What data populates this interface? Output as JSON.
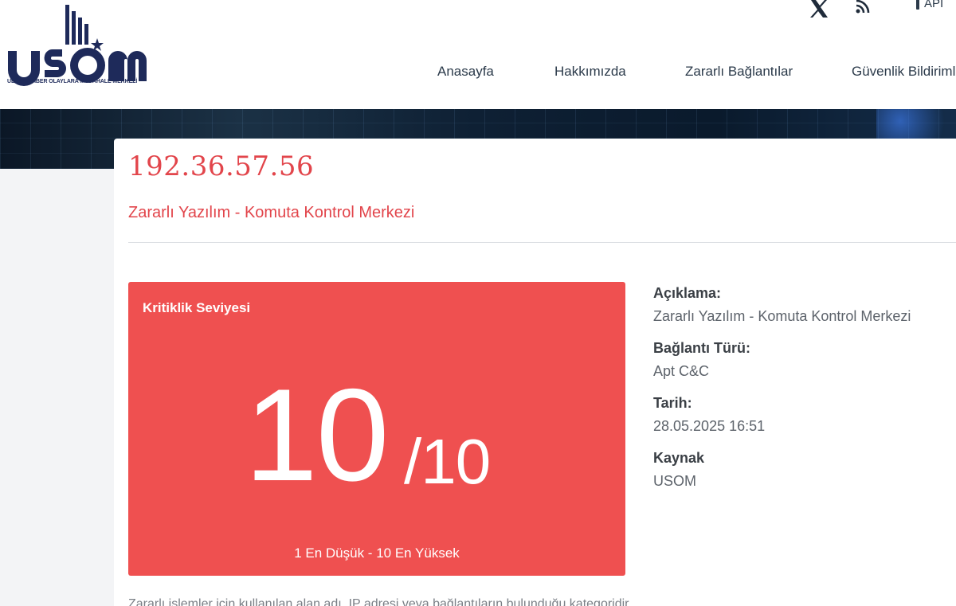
{
  "logo": {
    "text": "USOM",
    "subtitle": "ULUSAL SİBER OLAYLARA MÜDAHALE MERKEZİ"
  },
  "topbar": {
    "x_icon": "x-twitter-icon",
    "rss_icon": "rss-icon",
    "api_label": "API"
  },
  "nav": {
    "items": [
      "Anasayfa",
      "Hakkımızda",
      "Zararlı Bağlantılar",
      "Güvenlik Bildirimle"
    ]
  },
  "record": {
    "ip": "192.36.57.56",
    "subtitle": "Zararlı Yazılım - Komuta Kontrol Merkezi"
  },
  "criticality": {
    "label": "Kritiklik Seviyesi",
    "score": "10",
    "max": "/10",
    "range": "1 En Düşük - 10 En Yüksek"
  },
  "details": {
    "description_label": "Açıklama:",
    "description_value": "Zararlı Yazılım - Komuta Kontrol Merkezi",
    "type_label": "Bağlantı Türü:",
    "type_value": "Apt C&C",
    "date_label": "Tarih:",
    "date_value": "28.05.2025 16:51",
    "source_label": "Kaynak",
    "source_value": "USOM"
  },
  "footnote": "Zararlı işlemler için kullanılan alan adı, IP adresi veya bağlantıların bulunduğu kategoridir."
}
